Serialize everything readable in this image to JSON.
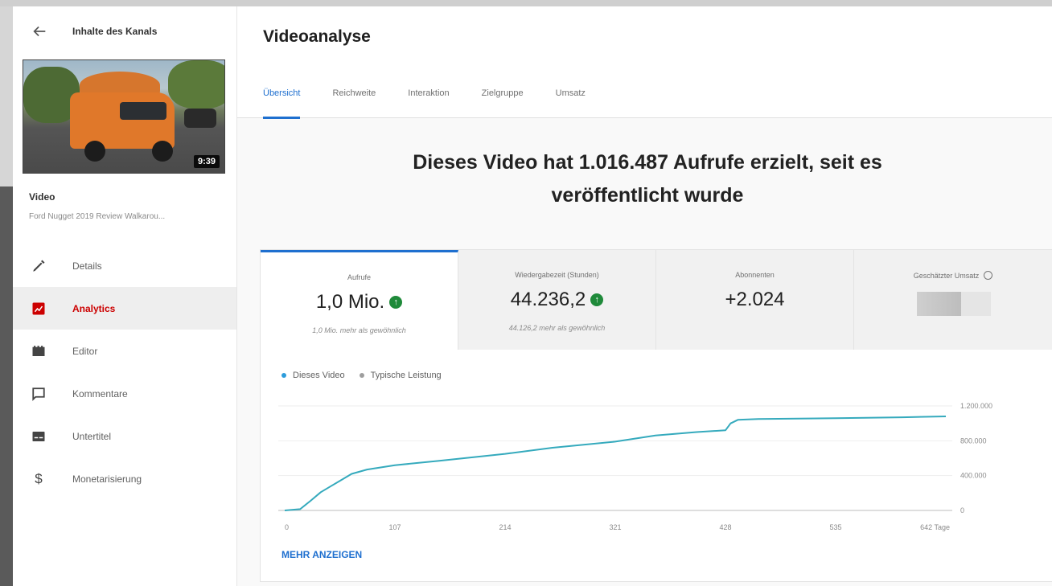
{
  "sidebar": {
    "title": "Inhalte des Kanals",
    "thumbnail": {
      "duration": "9:39"
    },
    "video_label": "Video",
    "video_title": "Ford Nugget 2019 Review Walkarou...",
    "items": [
      {
        "label": "Details",
        "icon": "pencil-icon"
      },
      {
        "label": "Analytics",
        "icon": "analytics-icon"
      },
      {
        "label": "Editor",
        "icon": "editor-icon"
      },
      {
        "label": "Kommentare",
        "icon": "comment-icon"
      },
      {
        "label": "Untertitel",
        "icon": "subtitles-icon"
      },
      {
        "label": "Monetarisierung",
        "icon": "dollar-icon"
      }
    ]
  },
  "main": {
    "title": "Videoanalyse",
    "tabs": [
      "Übersicht",
      "Reichweite",
      "Interaktion",
      "Zielgruppe",
      "Umsatz"
    ],
    "headline_line1": "Dieses Video hat 1.016.487 Aufrufe erzielt, seit es",
    "headline_line2": "veröffentlicht wurde",
    "metrics": [
      {
        "label": "Aufrufe",
        "value": "1,0 Mio.",
        "note": "1,0 Mio. mehr als gewöhnlich"
      },
      {
        "label": "Wiedergabezeit (Stunden)",
        "value": "44.236,2",
        "note": "44.126,2 mehr als gewöhnlich"
      },
      {
        "label": "Abonnenten",
        "value": "+2.024"
      },
      {
        "label": "Geschätzter Umsatz"
      }
    ],
    "show_more": "MEHR ANZEIGEN"
  },
  "colors": {
    "accent": "#1e6fcf",
    "active_nav": "#cc0000",
    "line": "#35aabd",
    "typical": "#9e9e9e"
  },
  "chart_data": {
    "type": "line",
    "series": [
      {
        "name": "Dieses Video",
        "x": [
          0,
          15,
          25,
          35,
          45,
          55,
          65,
          80,
          107,
          150,
          214,
          260,
          321,
          360,
          400,
          428,
          433,
          440,
          460,
          535,
          600,
          642
        ],
        "values": [
          0,
          15000,
          110000,
          210000,
          280000,
          350000,
          420000,
          470000,
          520000,
          570000,
          650000,
          720000,
          790000,
          860000,
          900000,
          920000,
          1000000,
          1040000,
          1050000,
          1060000,
          1070000,
          1080000
        ]
      },
      {
        "name": "Typische Leistung",
        "x": [],
        "values": []
      }
    ],
    "x_ticks": [
      "0",
      "107",
      "214",
      "321",
      "428",
      "535",
      "642 Tage"
    ],
    "y_ticks": [
      "0",
      "400.000",
      "800.000",
      "1.200.000"
    ],
    "xlim": [
      0,
      642
    ],
    "ylim": [
      0,
      1200000
    ],
    "grid": true,
    "legend_position": "top-left"
  }
}
